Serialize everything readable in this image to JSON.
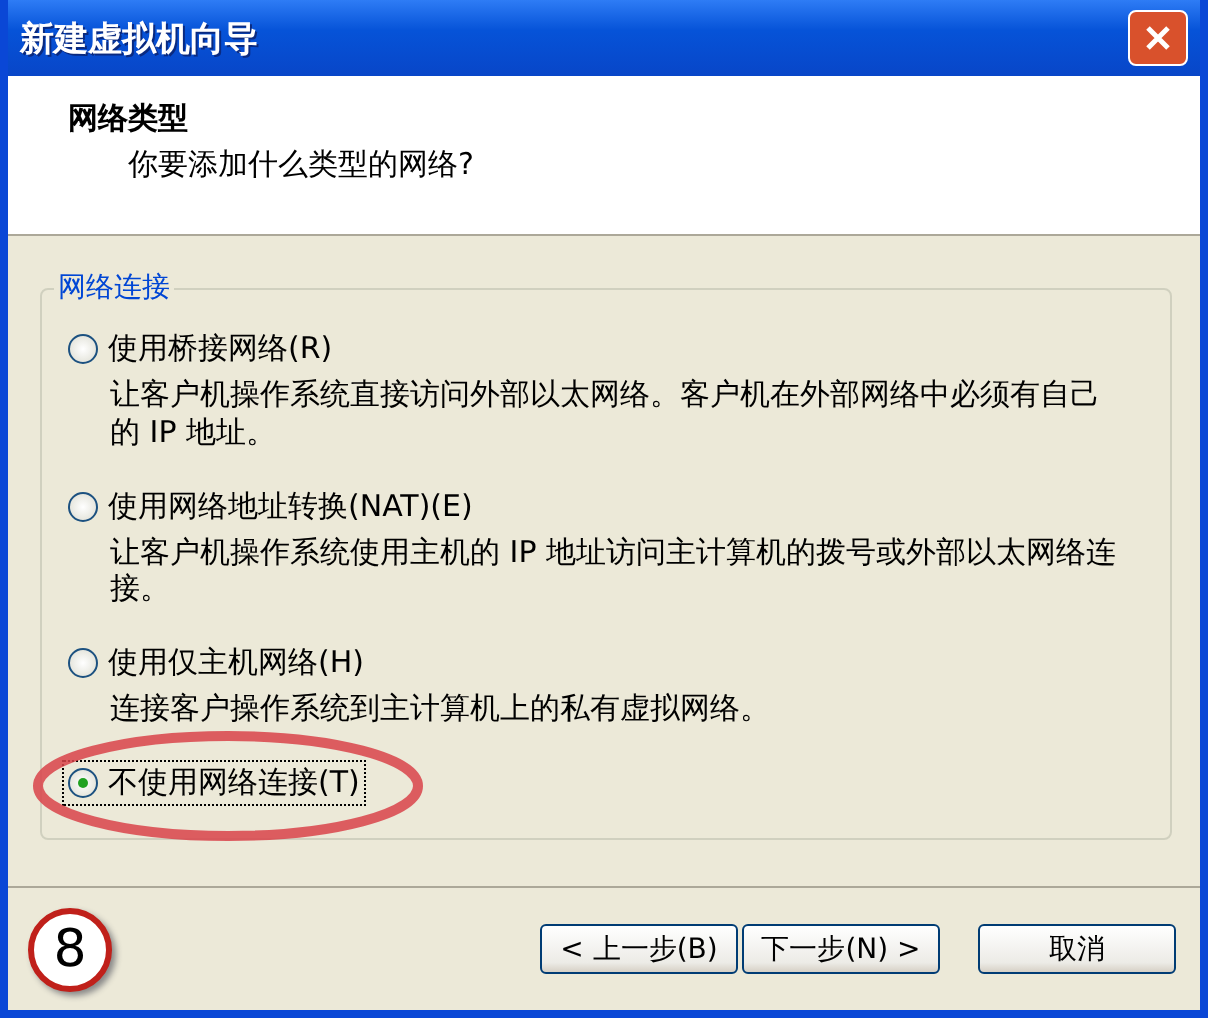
{
  "window": {
    "title": "新建虚拟机向导"
  },
  "header": {
    "title": "网络类型",
    "subtitle": "你要添加什么类型的网络?"
  },
  "group": {
    "title": "网络连接",
    "options": [
      {
        "label": "使用桥接网络(R)",
        "description": "让客户机操作系统直接访问外部以太网络。客户机在外部网络中必须有自己的 IP 地址。",
        "selected": false
      },
      {
        "label": "使用网络地址转换(NAT)(E)",
        "description": "让客户机操作系统使用主机的 IP 地址访问主计算机的拨号或外部以太网络连接。",
        "selected": false
      },
      {
        "label": "使用仅主机网络(H)",
        "description": "连接客户操作系统到主计算机上的私有虚拟网络。",
        "selected": false
      },
      {
        "label": "不使用网络连接(T)",
        "selected": true
      }
    ]
  },
  "step_badge": "8",
  "buttons": [
    {
      "label": "< 上一步(B)"
    },
    {
      "label": "下一步(N) >"
    },
    {
      "label": "取消"
    }
  ]
}
